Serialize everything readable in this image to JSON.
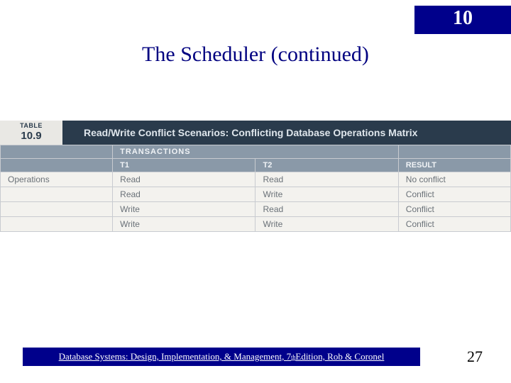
{
  "chapter_number": "10",
  "slide_title": "The Scheduler (continued)",
  "table": {
    "label": "TABLE",
    "number": "10.9",
    "title": "Read/Write Conflict Scenarios: Conflicting Database Operations Matrix",
    "section_header": "TRANSACTIONS",
    "sub_headers": {
      "t1": "T1",
      "t2": "T2",
      "result": "RESULT"
    },
    "row_label": "Operations",
    "rows": [
      {
        "t1": "Read",
        "t2": "Read",
        "result": "No conflict"
      },
      {
        "t1": "Read",
        "t2": "Write",
        "result": "Conflict"
      },
      {
        "t1": "Write",
        "t2": "Read",
        "result": "Conflict"
      },
      {
        "t1": "Write",
        "t2": "Write",
        "result": "Conflict"
      }
    ]
  },
  "footer": {
    "prefix": "Database Systems: Design, Implementation, & Management, 7",
    "ord": "th",
    "suffix": " Edition, Rob & Coronel"
  },
  "page_number": "27",
  "chart_data": {
    "type": "table",
    "title": "Read/Write Conflict Scenarios: Conflicting Database Operations Matrix",
    "columns": [
      "T1",
      "T2",
      "RESULT"
    ],
    "rows": [
      [
        "Read",
        "Read",
        "No conflict"
      ],
      [
        "Read",
        "Write",
        "Conflict"
      ],
      [
        "Write",
        "Read",
        "Conflict"
      ],
      [
        "Write",
        "Write",
        "Conflict"
      ]
    ]
  }
}
